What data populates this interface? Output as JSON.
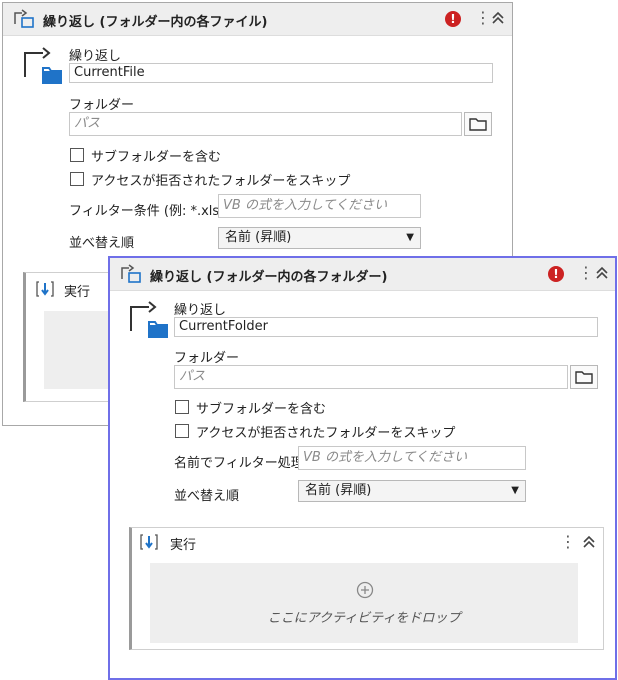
{
  "back": {
    "title": "繰り返し (フォルダー内の各ファイル)",
    "loop_label": "繰り返し",
    "loop_value": "CurrentFile",
    "folder_label": "フォルダー",
    "folder_placeholder": "パス",
    "include_sub": "サブフォルダーを含む",
    "skip_denied": "アクセスが拒否されたフォルダーをスキップ",
    "filter_label": "フィルター条件 (例: *.xlsx)",
    "filter_placeholder": "VB の式を入力してください",
    "sort_label": "並べ替え順",
    "sort_value": "名前 (昇順)",
    "body_title": "実行"
  },
  "front": {
    "title": "繰り返し (フォルダー内の各フォルダー)",
    "loop_label": "繰り返し",
    "loop_value": "CurrentFolder",
    "folder_label": "フォルダー",
    "folder_placeholder": "パス",
    "include_sub": "サブフォルダーを含む",
    "skip_denied": "アクセスが拒否されたフォルダーをスキップ",
    "filter_label": "名前でフィルター処理",
    "filter_placeholder": "VB の式を入力してください",
    "sort_label": "並べ替え順",
    "sort_value": "名前 (昇順)",
    "body_title": "実行",
    "drop_text": "ここにアクティビティをドロップ"
  },
  "icons": {
    "error": "!",
    "menu": "⋮",
    "activity": "loop-activity-icon",
    "sequence": "sequence-icon"
  },
  "colors": {
    "error": "#cc2222",
    "folder_blue": "#1f73c8",
    "selection_border": "#6f6fe8"
  }
}
